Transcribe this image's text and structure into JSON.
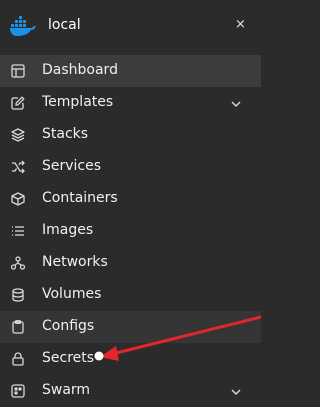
{
  "environment": {
    "name": "local",
    "close_glyph": "×"
  },
  "sidebar": {
    "items": [
      {
        "label": "Dashboard",
        "icon": "dashboard-icon"
      },
      {
        "label": "Templates",
        "icon": "edit-icon",
        "expandable": true
      },
      {
        "label": "Stacks",
        "icon": "layers-icon"
      },
      {
        "label": "Services",
        "icon": "shuffle-icon"
      },
      {
        "label": "Containers",
        "icon": "box-icon"
      },
      {
        "label": "Images",
        "icon": "list-icon"
      },
      {
        "label": "Networks",
        "icon": "network-icon"
      },
      {
        "label": "Volumes",
        "icon": "database-icon"
      },
      {
        "label": "Configs",
        "icon": "clipboard-icon"
      },
      {
        "label": "Secrets",
        "icon": "lock-icon"
      },
      {
        "label": "Swarm",
        "icon": "swarm-icon",
        "expandable": true
      }
    ]
  },
  "colors": {
    "background": "#2b2b2b",
    "active_item": "#3c3c3c",
    "docker_blue": "#1d91e6",
    "annotation_red": "#e3262b"
  }
}
